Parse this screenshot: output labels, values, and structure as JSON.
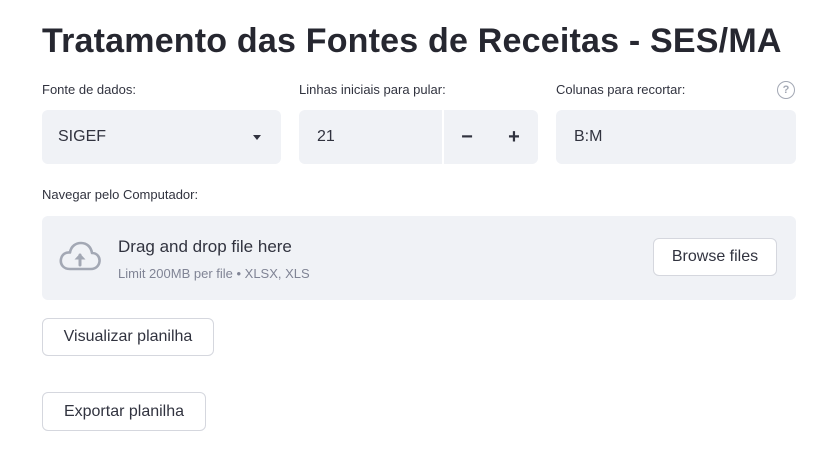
{
  "title": "Tratamento das Fontes de Receitas - SES/MA",
  "fields": {
    "fonte": {
      "label": "Fonte de dados:",
      "value": "SIGEF"
    },
    "linhas": {
      "label": "Linhas iniciais para pular:",
      "value": "21",
      "minus": "−",
      "plus": "+"
    },
    "colunas": {
      "label": "Colunas para recortar:",
      "value": "B:M",
      "help": "?"
    }
  },
  "upload": {
    "label": "Navegar pelo Computador:",
    "drag_text": "Drag and drop file here",
    "limit_text": "Limit 200MB per file • XLSX, XLS",
    "browse_label": "Browse files",
    "icon": "cloud-upload-icon"
  },
  "buttons": {
    "visualizar": "Visualizar planilha",
    "exportar": "Exportar planilha"
  }
}
